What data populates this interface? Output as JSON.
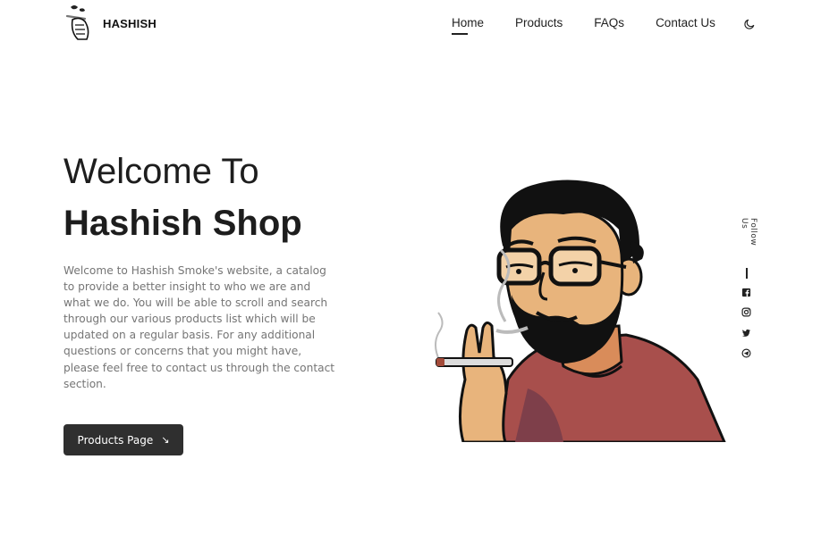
{
  "header": {
    "brand": "HASHISH",
    "nav": [
      {
        "label": "Home",
        "active": true
      },
      {
        "label": "Products",
        "active": false
      },
      {
        "label": "FAQs",
        "active": false
      },
      {
        "label": "Contact Us",
        "active": false
      }
    ],
    "theme_toggle_icon": "moon-icon"
  },
  "hero": {
    "title_line1": "Welcome To",
    "title_line2": "Hashish Shop",
    "description": "Welcome to Hashish Smoke's website, a catalog to provide a better insight to who we are and what we do. You will be able to scroll and search through our various products list which will be updated on a regular basis. For any additional questions or concerns that you might have, please feel free to contact us through the contact section.",
    "cta_label": "Products Page",
    "cta_icon": "arrow-down-right-icon"
  },
  "social": {
    "label": "Follow Us",
    "icons": [
      "facebook-icon",
      "instagram-icon",
      "twitter-icon",
      "telegram-icon"
    ]
  },
  "colors": {
    "text_dark": "#1d1d1d",
    "text_muted": "#757575",
    "button_bg": "#2f2f2f",
    "shirt": "#a84f4c",
    "skin": "#e8b47c"
  }
}
